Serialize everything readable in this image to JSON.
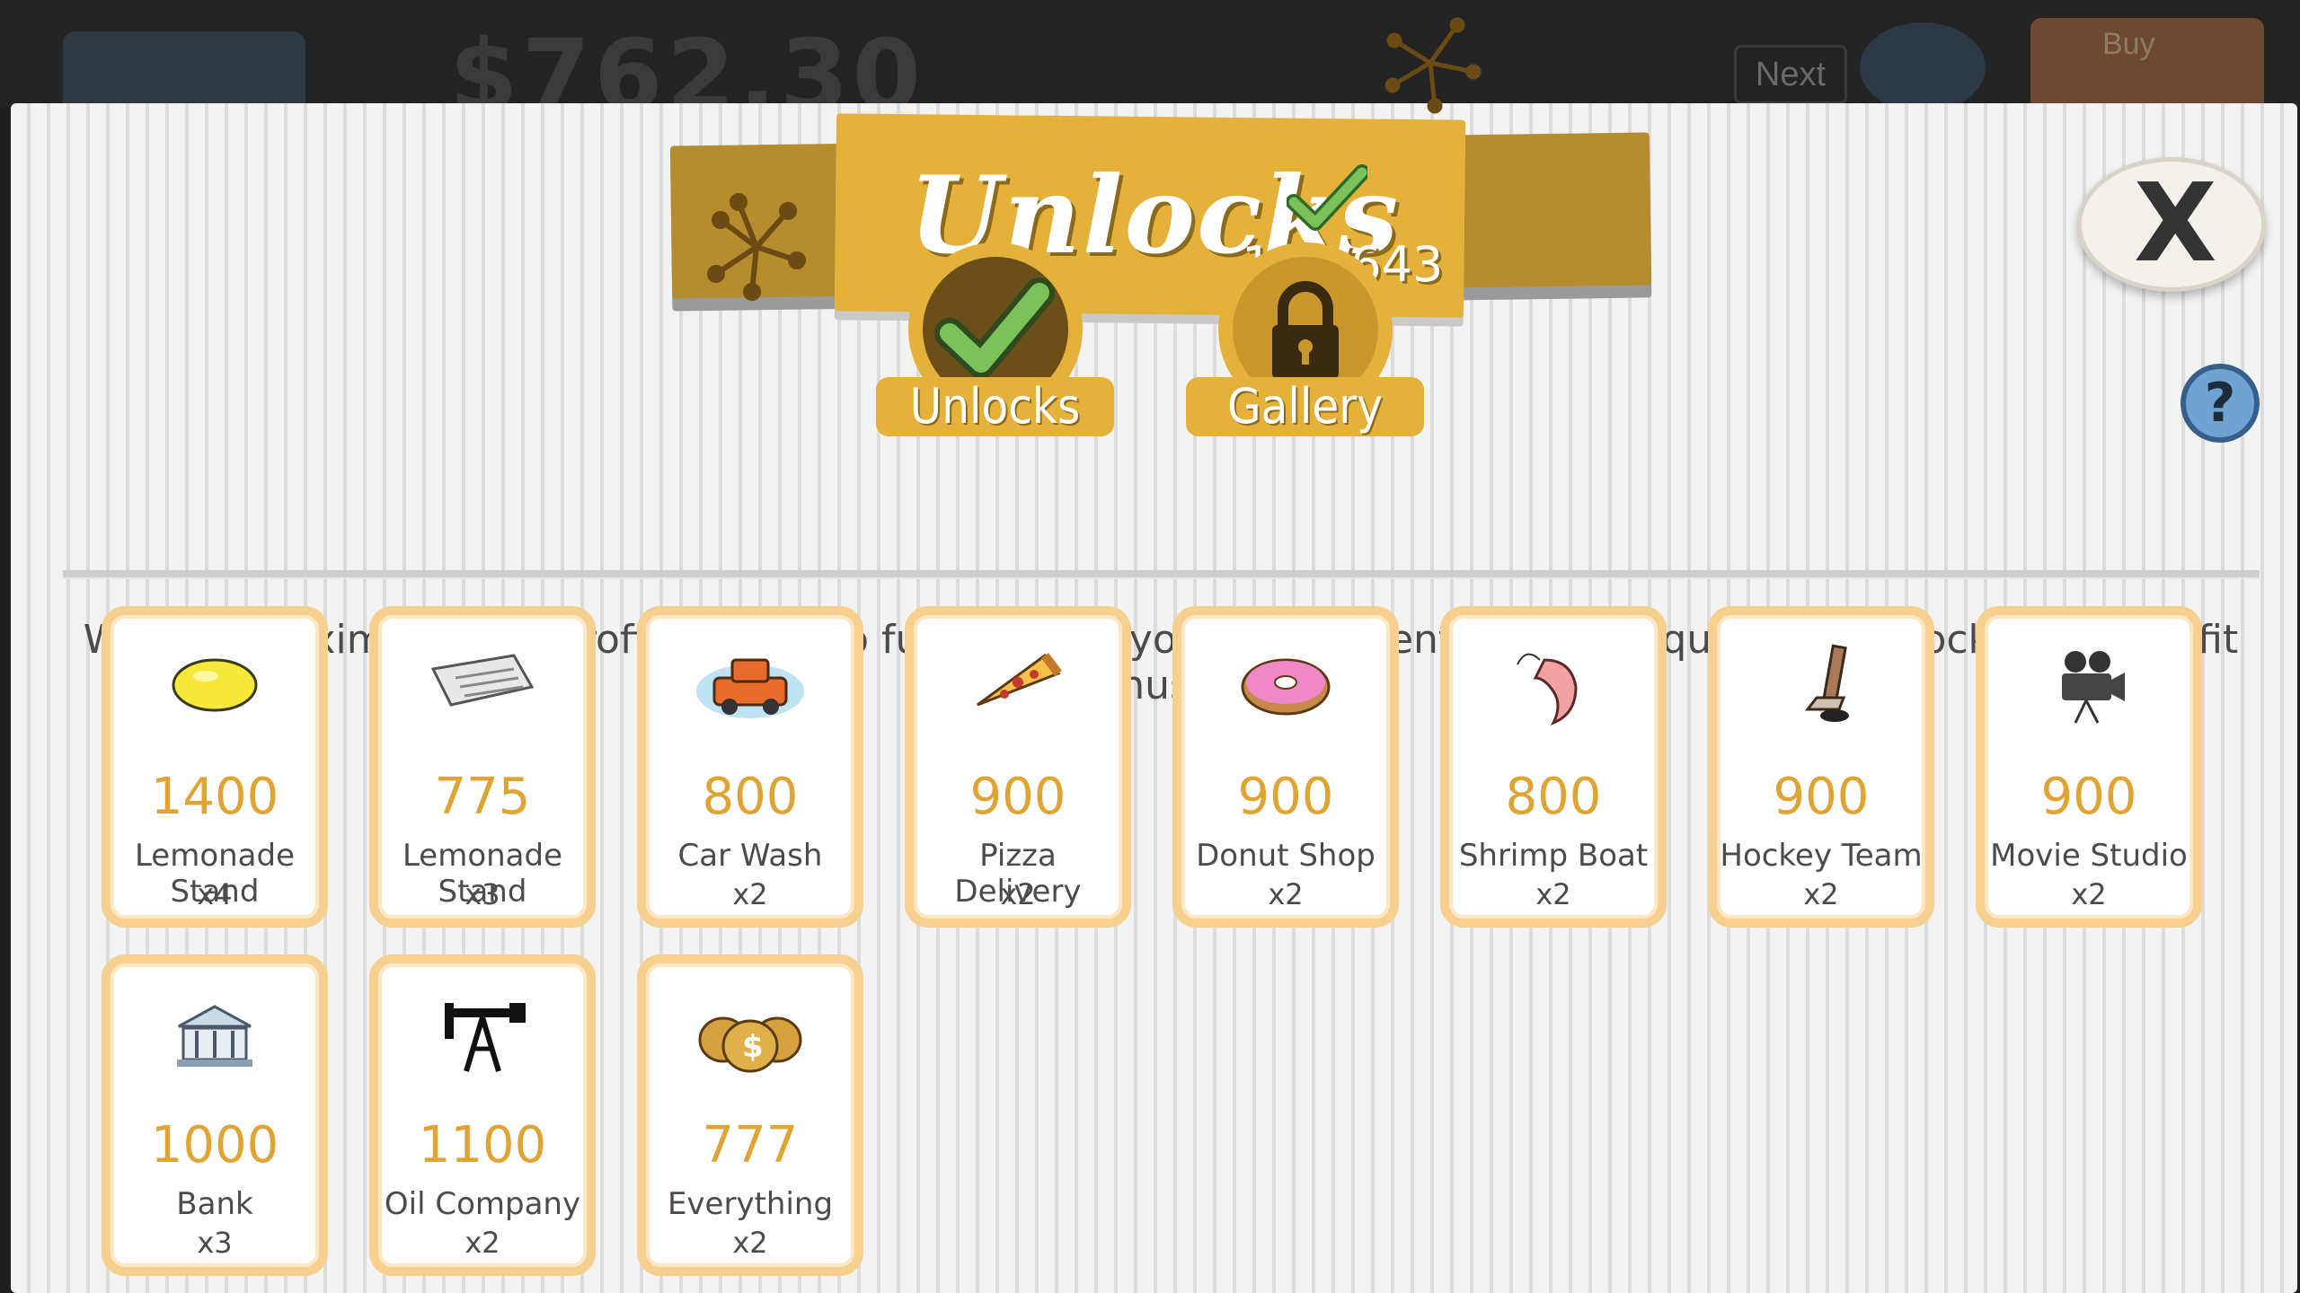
{
  "background": {
    "money_text": "$762,30",
    "next_label": "Next",
    "buy_label": "Buy"
  },
  "header": {
    "title": "Unlocks",
    "count": "141/643"
  },
  "tabs": [
    {
      "label": "Unlocks",
      "icon": "checkmark-icon",
      "selected": true
    },
    {
      "label": "Gallery",
      "icon": "padlock-icon",
      "selected": false
    }
  ],
  "close_label": "X",
  "help_label": "?",
  "intro_text": "Want to maximize your profits? Look no further! Get your investments to these quotas to unlock sweet profit bonuses!",
  "unlocks": [
    {
      "amount": "1400",
      "name": "Lemonade Stand",
      "multiplier": "x4",
      "icon": "lemon-icon"
    },
    {
      "amount": "775",
      "name": "Lemonade Stand",
      "multiplier": "x3",
      "icon": "newspaper-icon"
    },
    {
      "amount": "800",
      "name": "Car Wash",
      "multiplier": "x2",
      "icon": "car-icon"
    },
    {
      "amount": "900",
      "name": "Pizza Delivery",
      "multiplier": "x2",
      "icon": "pizza-icon"
    },
    {
      "amount": "900",
      "name": "Donut Shop",
      "multiplier": "x2",
      "icon": "donut-icon"
    },
    {
      "amount": "800",
      "name": "Shrimp Boat",
      "multiplier": "x2",
      "icon": "shrimp-icon"
    },
    {
      "amount": "900",
      "name": "Hockey Team",
      "multiplier": "x2",
      "icon": "hockey-stick-icon"
    },
    {
      "amount": "900",
      "name": "Movie Studio",
      "multiplier": "x2",
      "icon": "movie-camera-icon"
    },
    {
      "amount": "1000",
      "name": "Bank",
      "multiplier": "x3",
      "icon": "bank-icon"
    },
    {
      "amount": "1100",
      "name": "Oil Company",
      "multiplier": "x2",
      "icon": "oil-derrick-icon"
    },
    {
      "amount": "777",
      "name": "Everything",
      "multiplier": "x2",
      "icon": "money-bags-icon"
    }
  ],
  "colors": {
    "gold": "#e4b13a",
    "card_border": "#f7cf8e",
    "amount": "#e0a434",
    "check_green": "#6ab04c"
  }
}
